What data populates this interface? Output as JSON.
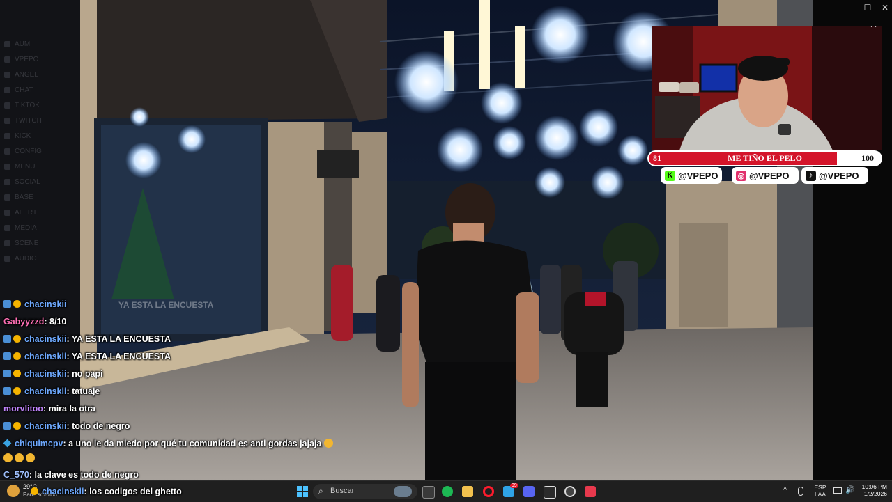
{
  "left_app": {
    "rows": [
      "AUM",
      "VPEPO",
      "ANGEL",
      "CHAT",
      "TIKTOK",
      "TWITCH",
      "KICK",
      "CONFIG",
      "MENU",
      "SOCIAL",
      "BASE",
      "ALERT",
      "MEDIA",
      "SCENE",
      "AUDIO"
    ]
  },
  "chat": {
    "ghost_text": "YA ESTA LA ENCUESTA",
    "messages": [
      {
        "user": "chacinskii",
        "badges": true,
        "text": "",
        "user_color": "#6ea9ff"
      },
      {
        "user": "Gabyyzzd",
        "badges": false,
        "text": ": 8/10",
        "user_color": "#ff6fb5"
      },
      {
        "user": "chacinskii",
        "badges": true,
        "text": ": YA ESTA LA ENCUESTA",
        "user_color": "#6ea9ff"
      },
      {
        "user": "chacinskii",
        "badges": true,
        "text": ": YA ESTA LA ENCUESTA",
        "user_color": "#6ea9ff"
      },
      {
        "user": "chacinskii",
        "badges": true,
        "text": ": no papi",
        "user_color": "#6ea9ff"
      },
      {
        "user": "chacinskii",
        "badges": true,
        "text": ": tatuaje",
        "user_color": "#6ea9ff"
      },
      {
        "user": "morvlitoo",
        "badges": false,
        "text": ": mira la otra",
        "user_color": "#c084fc"
      },
      {
        "user": "chacinskii",
        "badges": true,
        "text": ": todo de negro",
        "user_color": "#6ea9ff"
      },
      {
        "user": "chiquimcpv",
        "badges": false,
        "text": ": a uno le da miedo por qué tu comunidad es anti gordas jajaja",
        "user_color": "#6ea9ff"
      },
      {
        "user": "C_570",
        "badges": false,
        "text": ": la clave es todo de negro",
        "user_color": "#9fc0ff"
      },
      {
        "user": "chacinskii",
        "badges": true,
        "text": ": los codigos del ghetto",
        "user_color": "#6ea9ff"
      }
    ]
  },
  "overlay": {
    "goal_start": "81",
    "goal_title": "ME TIÑO EL PELO",
    "goal_end": "100",
    "goal_progress": 0.81,
    "colors": {
      "goal_bar": "#d4142a",
      "accent_red": "#b71c1c"
    },
    "socials": [
      {
        "icon": "kick-icon",
        "handle": "@VPEPO",
        "color": "#53fc18",
        "glyph": "K"
      },
      {
        "icon": "instagram-icon",
        "handle": "@VPEPO_",
        "color": "#e1306c",
        "glyph": "◎"
      },
      {
        "icon": "tiktok-icon",
        "handle": "@VPEPO_",
        "color": "#111111",
        "glyph": "♪"
      }
    ]
  },
  "window": {
    "minimize": "—",
    "maximize": "☐",
    "close": "✕",
    "overlay_close": "✕"
  },
  "taskbar": {
    "weather_temp": "29°C",
    "weather_desc": "Parc. soleado",
    "search_placeholder": "Buscar",
    "lang_top": "ESP",
    "lang_bottom": "LAA",
    "time": "10:06 PM",
    "date": "1/2/2026",
    "badge_count": "99",
    "tray_chevron": "^"
  }
}
